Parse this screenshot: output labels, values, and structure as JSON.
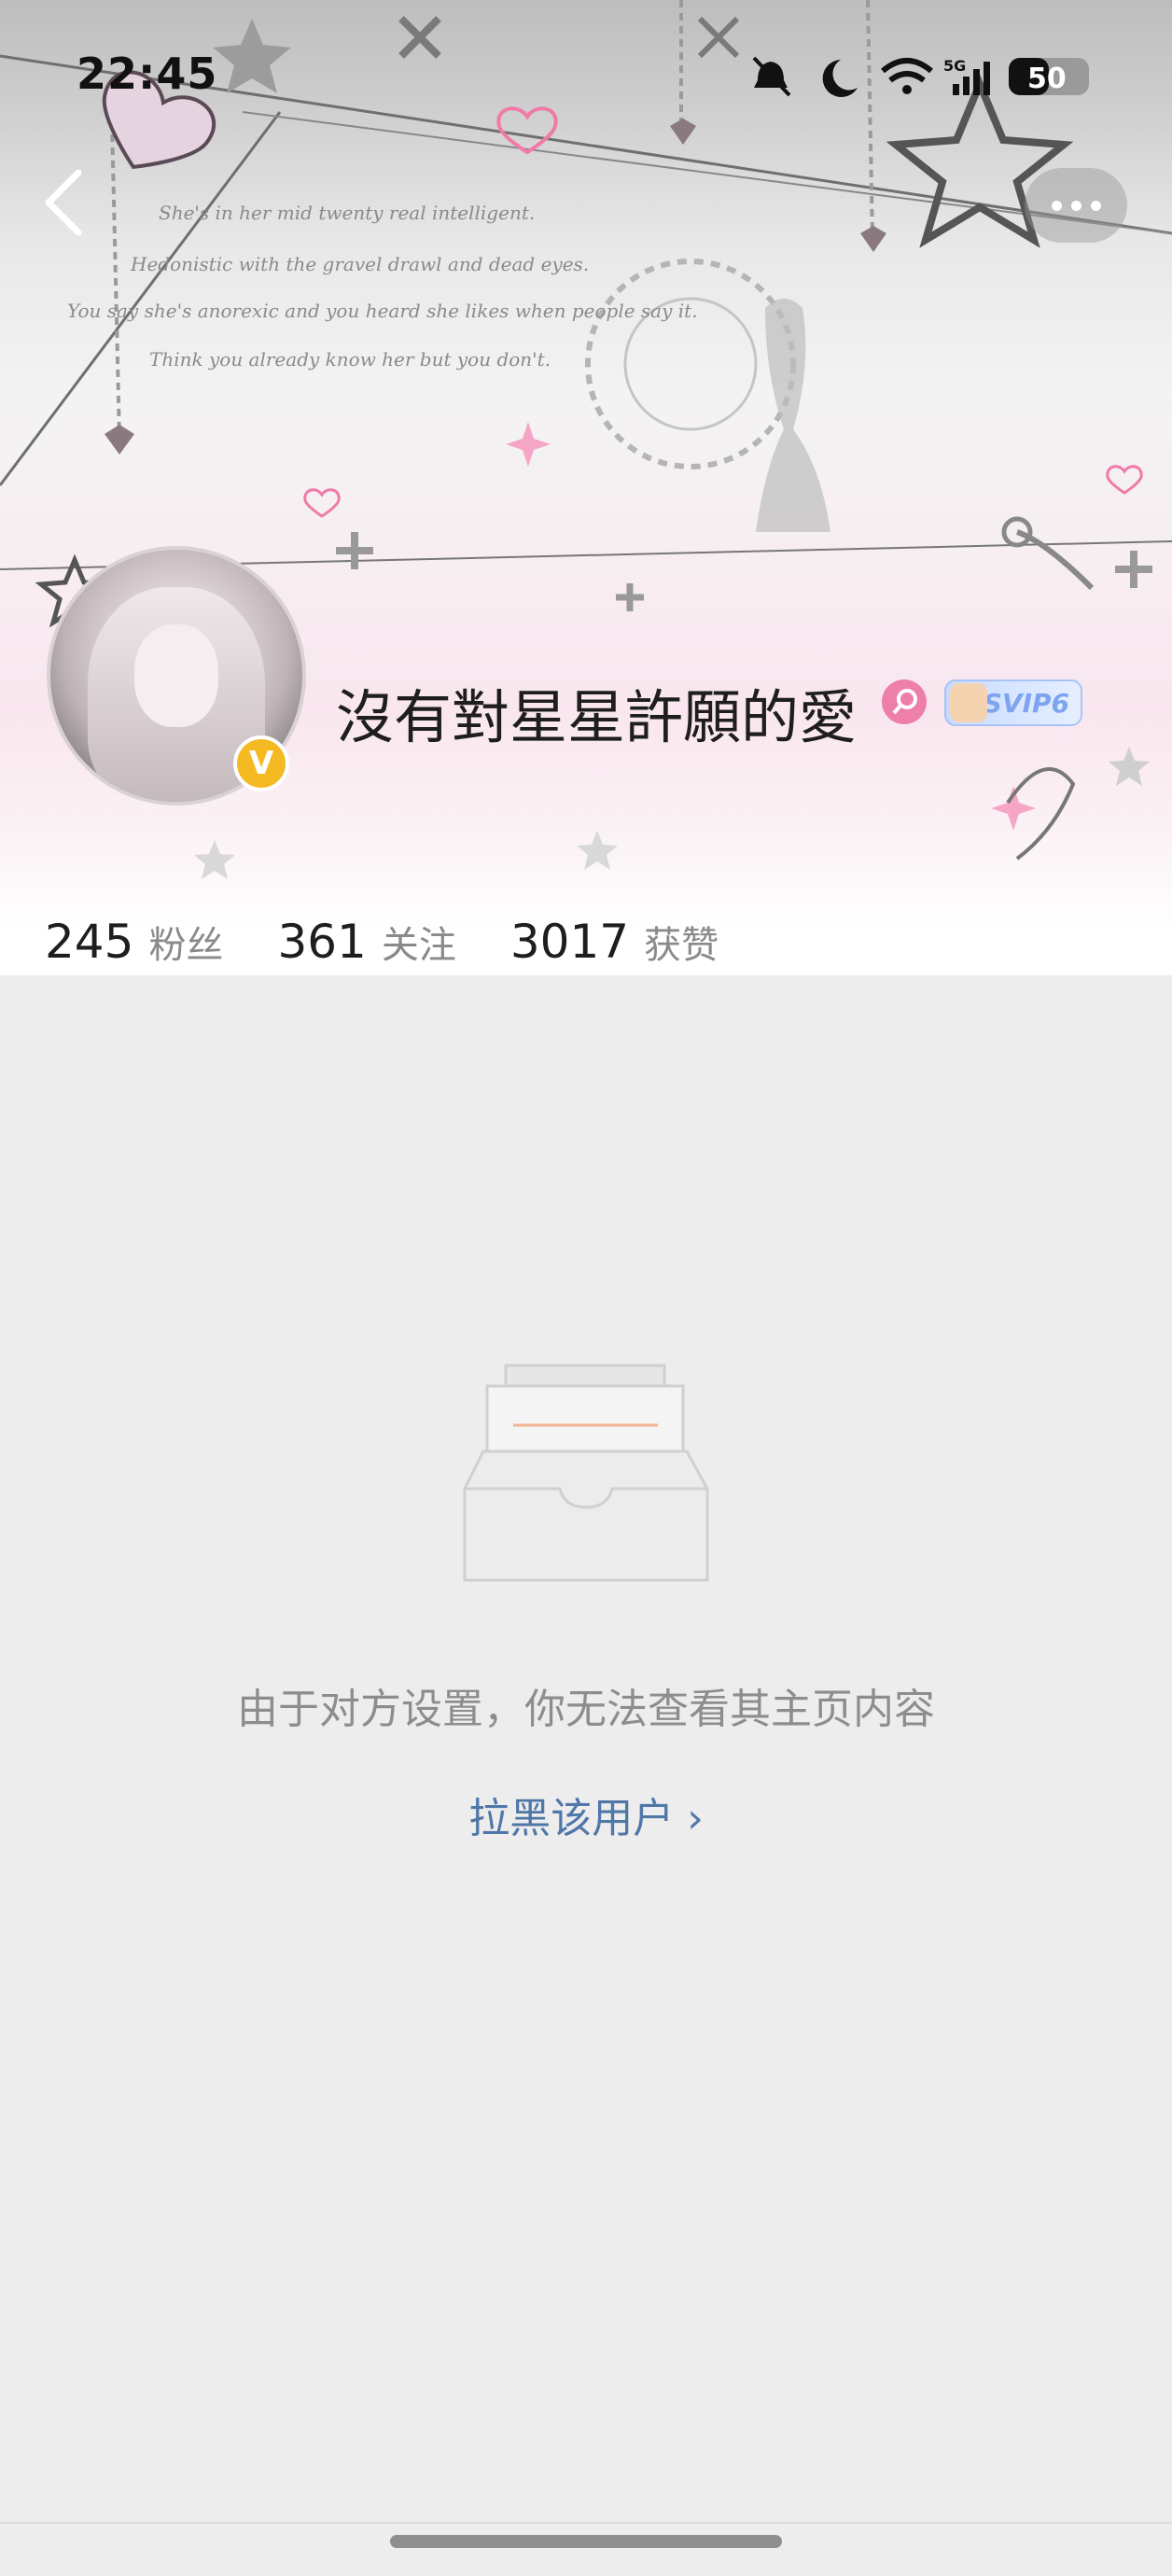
{
  "status_bar": {
    "time": "22:45",
    "network": "5G",
    "battery": "50"
  },
  "profile": {
    "username": "沒有對星星許願的愛",
    "verified_badge": "V",
    "vip_badge": "SVIP6",
    "gender_icon": "female-icon"
  },
  "stats": [
    {
      "value": "245",
      "label": "粉丝"
    },
    {
      "value": "361",
      "label": "关注"
    },
    {
      "value": "3017",
      "label": "获赞"
    }
  ],
  "empty_state": {
    "message": "由于对方设置，你无法查看其主页内容",
    "block_link": "拉黑该用户 ›"
  },
  "colors": {
    "link": "#4f77a8",
    "badge_verified": "#f5b921",
    "accent_pink": "#ee7eaa",
    "line_accent": "#f0b394"
  }
}
